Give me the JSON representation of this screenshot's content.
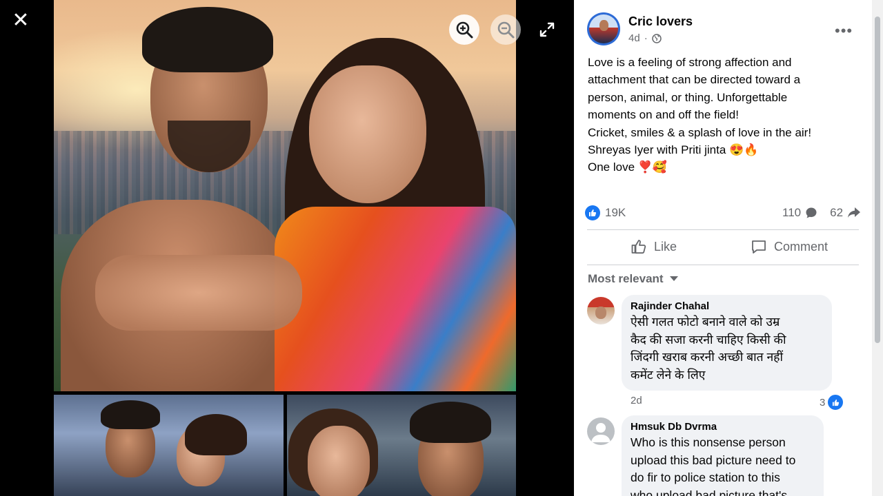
{
  "viewer": {
    "close_icon": "✕",
    "photo_description_icon": "photo",
    "controls": [
      "zoom-in",
      "zoom-out",
      "fullscreen"
    ]
  },
  "post": {
    "page_name": "Cric lovers",
    "time": "4d",
    "privacy_icon": "globe",
    "more_label": "•••",
    "text_lines": [
      "Love is a feeling of strong affection and",
      "attachment that can be directed toward a",
      "person, animal, or thing. Unforgettable",
      "moments on and off the field!",
      "Cricket, smiles & a splash of love in the air!",
      "Shreyas Iyer with Priti jinta 😍🔥",
      "One love ❣️🥰"
    ],
    "reactions_count": "19K",
    "comments_count": "110",
    "shares_count": "62"
  },
  "actions": {
    "like_label": "Like",
    "comment_label": "Comment"
  },
  "comments_section": {
    "sort_label": "Most relevant",
    "comments": [
      {
        "author": "Rajinder Chahal",
        "lines": [
          "ऐसी गलत फोटो बनाने वाले को उम्र",
          "कैद की सजा करनी चाहिए किसी की",
          "जिंदगी खराब करनी अच्छी बात नहीं",
          "कमेंट लेने के लिए"
        ],
        "time": "2d",
        "reactions": "3"
      },
      {
        "author": "Hmsuk Db Dvrma",
        "lines": [
          "Who is this nonsense person",
          "upload this bad picture need to",
          "do fir to police station to this",
          "who upload bad picture that's"
        ]
      }
    ]
  },
  "colors": {
    "accent": "#1877f2",
    "secondary_text": "#65676b",
    "bubble": "#f0f2f5"
  }
}
